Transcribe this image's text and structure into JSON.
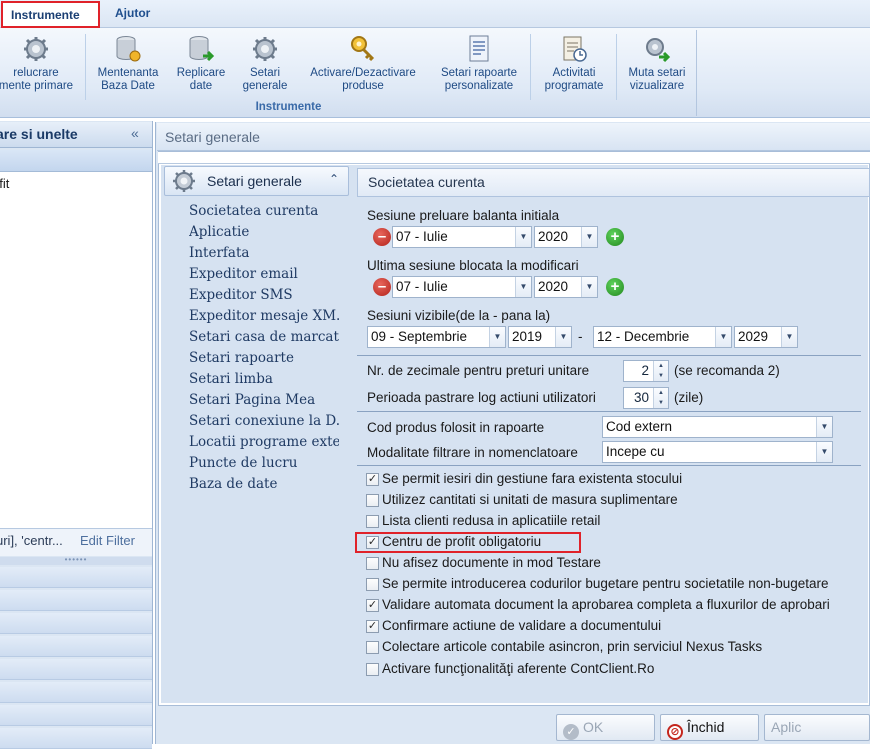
{
  "menu": {
    "instrumente": "Instrumente",
    "ajutor": "Ajutor"
  },
  "ribbon": {
    "buttons": [
      {
        "line1": "relucrare",
        "line2": "mente primare"
      },
      {
        "line1": "Mentenanta",
        "line2": "Baza Date"
      },
      {
        "line1": "Replicare",
        "line2": "date"
      },
      {
        "line1": "Setari",
        "line2": "generale"
      },
      {
        "line1": "Activare/Dezactivare",
        "line2": "produse"
      },
      {
        "line1": "Setari rapoarte",
        "line2": "personalizate"
      },
      {
        "line1": "Activitati",
        "line2": "programate"
      },
      {
        "line1": "Muta setari",
        "line2": "vizualizare"
      }
    ],
    "group_label": "Instrumente"
  },
  "left_pane": {
    "header": "are si unelte",
    "collapse": "«",
    "row": "ofit",
    "filter_text": "uri], 'centr...",
    "edit_filter": "Edit Filter",
    "grip": "••••••"
  },
  "window": {
    "title": "Setari generale"
  },
  "nav": {
    "header": "Setari generale",
    "chevron": "⌃",
    "items": [
      "Societatea curenta",
      "Aplicatie",
      "Interfata",
      "Expeditor email",
      "Expeditor SMS",
      "Expeditor mesaje XM...",
      "Setari casa de marcat",
      "Setari rapoarte",
      "Setari limba",
      "Setari Pagina Mea",
      "Setari conexiune la D...",
      "Locatii programe exte...",
      "Puncte de lucru",
      "Baza de date"
    ]
  },
  "content": {
    "title": "Societatea curenta",
    "sesiune_preluare": {
      "label": "Sesiune preluare balanta initiala",
      "month": "07 - Iulie",
      "year": "2020"
    },
    "ultima_sesiune": {
      "label": "Ultima sesiune blocata la modificari",
      "month": "07 - Iulie",
      "year": "2020"
    },
    "sesiuni_vizibile": {
      "label": "Sesiuni vizibile(de la - pana la)",
      "from_month": "09 - Septembrie",
      "from_year": "2019",
      "dash": "-",
      "to_month": "12 - Decembrie",
      "to_year": "2029"
    },
    "zecimale": {
      "label": "Nr. de zecimale pentru preturi unitare",
      "value": "2",
      "note": "(se recomanda 2)"
    },
    "log": {
      "label": "Perioada pastrare log actiuni utilizatori",
      "value": "30",
      "note": "(zile)"
    },
    "cod_produs": {
      "label": "Cod produs folosit in rapoarte",
      "value": "Cod extern"
    },
    "filtrare": {
      "label": "Modalitate filtrare in nomenclatoare",
      "value": "Incepe cu"
    },
    "checkboxes": [
      {
        "label": "Se permit iesiri din gestiune fara existenta stocului",
        "checked": true
      },
      {
        "label": "Utilizez cantitati si unitati de masura suplimentare",
        "checked": false
      },
      {
        "label": "Lista clienti redusa in aplicatiile retail",
        "checked": false
      },
      {
        "label": "Centru de profit obligatoriu",
        "checked": true
      },
      {
        "label": "Nu afisez documente in mod Testare",
        "checked": false
      },
      {
        "label": "Se permite introducerea codurilor bugetare pentru societatile non-bugetare",
        "checked": false
      },
      {
        "label": "Validare automata document la aprobarea completa a fluxurilor de aprobari",
        "checked": true
      },
      {
        "label": "Confirmare actiune de validare a documentului",
        "checked": true
      },
      {
        "label": "Colectare articole contabile asincron, prin serviciul Nexus Tasks",
        "checked": false
      },
      {
        "label": "Activare funcţionalităţi aferente ContClient.Ro",
        "checked": false
      }
    ]
  },
  "buttons": {
    "ok": "OK",
    "inchid": "Închid",
    "aplic": "Aplic"
  },
  "colors": {
    "accent": "#1f4f8e",
    "highlight": "#e0222a"
  }
}
